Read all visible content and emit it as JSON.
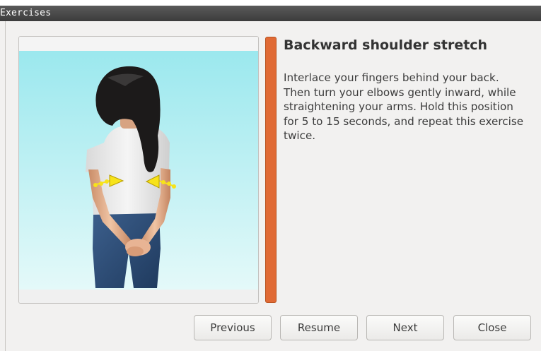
{
  "window": {
    "title": "Exercises"
  },
  "exercise": {
    "title": "Backward shoulder stretch",
    "description": "Interlace your fingers behind your back. Then turn your elbows gently inward, while straightening your arms. Hold this position for 5 to 15 seconds, and repeat this exercise twice.",
    "illustration": "woman-back-view-hands-clasped-behind-back"
  },
  "buttons": {
    "previous": "Previous",
    "resume": "Resume",
    "next": "Next",
    "close": "Close"
  },
  "colors": {
    "accent_bar": "#e06a35",
    "sky_top": "#9be8ee",
    "sky_bottom": "#e4f9f9",
    "arrow": "#f7e31a"
  }
}
